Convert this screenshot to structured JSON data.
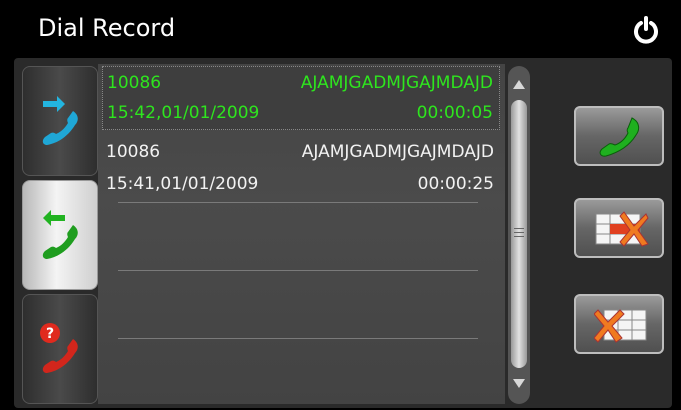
{
  "header": {
    "title": "Dial Record"
  },
  "icons": {
    "power": "power-icon"
  },
  "tabs": [
    {
      "name": "dialed-calls",
      "icon": "outgoing-call-icon",
      "active": false
    },
    {
      "name": "received-calls",
      "icon": "incoming-call-icon",
      "active": true
    },
    {
      "name": "missed-calls",
      "icon": "missed-call-icon",
      "active": false
    }
  ],
  "records": [
    {
      "number": "10086",
      "name": "AJAMJGADMJGAJMDAJD",
      "datetime": "15:42,01/01/2009",
      "duration": "00:00:05",
      "selected": true
    },
    {
      "number": "10086",
      "name": "AJAMJGADMJGAJMDAJD",
      "datetime": "15:41,01/01/2009",
      "duration": "00:00:25",
      "selected": false
    }
  ],
  "actions": [
    {
      "name": "call-button",
      "icon": "phone-icon"
    },
    {
      "name": "delete-record-button",
      "icon": "delete-one-icon"
    },
    {
      "name": "delete-all-button",
      "icon": "delete-all-icon"
    }
  ],
  "colors": {
    "selected_text": "#2ee51e",
    "normal_text": "#f2f2f2",
    "background": "#000000"
  }
}
